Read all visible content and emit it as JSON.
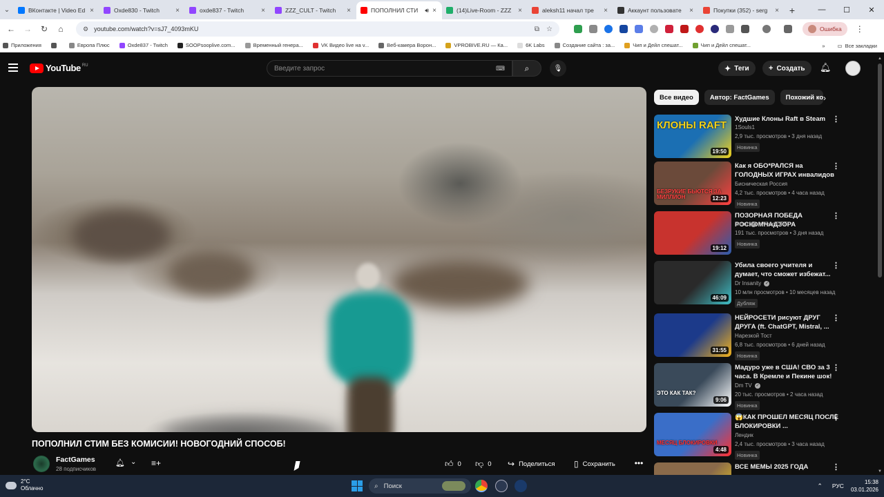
{
  "browser": {
    "tabs": [
      {
        "title": "ВКонтакте | Video Ed",
        "color": "#0077ff"
      },
      {
        "title": "Oxde830 - Twitch",
        "color": "#9146ff"
      },
      {
        "title": "oxde837 - Twitch",
        "color": "#9146ff"
      },
      {
        "title": "ZZZ_CULT - Twitch",
        "color": "#9146ff"
      },
      {
        "title": "ПОПОЛНИЛ СТИ",
        "color": "#ff0000",
        "active": true
      },
      {
        "title": "(14)Live-Room - ZZZ",
        "color": "#1fae6a"
      },
      {
        "title": "aleksh11 начал тре",
        "color": "#ea4335"
      },
      {
        "title": "Аккаунт пользовате",
        "color": "#333333"
      },
      {
        "title": "Покупки (352) - serg",
        "color": "#ea4335"
      }
    ],
    "url": "youtube.com/watch?v=sJ7_4093mKU",
    "error_label": "Ошибка",
    "bookmarks": [
      {
        "label": "Приложения",
        "color": "#555555"
      },
      {
        "label": "",
        "color": "#555555"
      },
      {
        "label": "Европа Плюс",
        "color": "#888888"
      },
      {
        "label": "Oxde837 - Twitch",
        "color": "#9146ff"
      },
      {
        "label": "SOOPsooplive.com...",
        "color": "#222222"
      },
      {
        "label": "Временный генера...",
        "color": "#999999"
      },
      {
        "label": "VK Видео live на v...",
        "color": "#e03030"
      },
      {
        "label": "Веб-камера Ворон...",
        "color": "#666666"
      },
      {
        "label": "VPROBIVE.RU — Ка...",
        "color": "#d4a21b"
      },
      {
        "label": "6K Labs",
        "color": "#dddddd"
      },
      {
        "label": "Создание сайта : за...",
        "color": "#888888"
      },
      {
        "label": "Чип и Дейл спешат...",
        "color": "#e0a020"
      },
      {
        "label": "Чип и Дейл спешат...",
        "color": "#70a030"
      }
    ],
    "all_bookmarks": "Все закладки"
  },
  "youtube": {
    "logo_text": "YouTube",
    "logo_country": "RU",
    "search_placeholder": "Введите запрос",
    "tags_label": "Теги",
    "create_label": "Создать",
    "video": {
      "title": "ПОПОЛНИЛ СТИМ БЕЗ КОМИСИИ! НОВОГОДНИЙ СПОСОБ!",
      "channel": "FactGames",
      "subscribers": "28 подписчиков",
      "likes": "0",
      "dislikes": "0",
      "share_label": "Поделиться",
      "save_label": "Сохранить"
    },
    "chips": [
      "Все видео",
      "Автор: FactGames",
      "Похожий ко"
    ],
    "recommendations": [
      {
        "title": "Худшие Клоны Raft в Steam",
        "channel": "1Souls1",
        "views": "2,9 тыс. просмотров • 3 дня назад",
        "badge": "Новинка",
        "duration": "19:50",
        "overlay": "КЛОНЫ RAFT",
        "bg": "#1b6fb3",
        "accent": "#f2d21b"
      },
      {
        "title": "Как я ОБО*РАЛСЯ на ГОЛОДНЫХ ИГРАХ инвалидов",
        "channel": "Бисническая Россия",
        "views": "4,2 тыс. просмотров • 4 часа назад",
        "badge": "Новинка",
        "duration": "12:23",
        "overlay": "БЕЗРУКИЕ БЬЮТСЯ ЗА МИЛЛИОН",
        "bg": "#6b4a3a",
        "accent": "#ff4040"
      },
      {
        "title": "ПОЗОРНАЯ ПОБЕДА РОСКОМНАДЗОРА",
        "channel": "слэш",
        "channel2": "и VeselOFF",
        "views": "191 тыс. просмотров • 3 дня назад",
        "badge": "Новинка",
        "duration": "19:12",
        "overlay": "",
        "bg": "#c8332e",
        "accent": "#2b5db0"
      },
      {
        "title": "Убила своего учителя и думает, что сможет избежат...",
        "channel": "Dr Insanity",
        "views": "10 млн просмотров • 10 месяцев назад",
        "badge": "Дубляж",
        "duration": "46:09",
        "overlay": "",
        "bg": "#2a2a2a",
        "accent": "#3fc0c8"
      },
      {
        "title": "НЕЙРОСЕТИ рисуют ДРУГ ДРУГА (ft. ChatGPT, Mistral, ...",
        "channel": "Нарезкой Тост",
        "views": "6,8 тыс. просмотров • 6 дней назад",
        "badge": "Новинка",
        "duration": "31:55",
        "overlay": "",
        "bg": "#1c3a8a",
        "accent": "#f2b21b"
      },
      {
        "title": "Мадуро уже в США! СВО за 3 часа. В Кремле и Пекине шок!",
        "channel": "Dm TV",
        "views": "20 тыс. просмотров • 2 часа назад",
        "badge": "Новинка",
        "duration": "9:06",
        "overlay": "ЭТО КАК ТАК?",
        "bg": "#3a4a5a",
        "accent": "#ffffff"
      },
      {
        "title": "😱КАК ПРОШЕЛ МЕСЯЦ ПОСЛЕ БЛОКИРОВКИ ...",
        "channel": "Лендик",
        "views": "2,4 тыс. просмотров • 3 часа назад",
        "badge": "Новинка",
        "duration": "4:48",
        "overlay": "МЕСЯЦ БЛОКИРОВКИ",
        "bg": "#3a6ec8",
        "accent": "#ff3030"
      },
      {
        "title": "ВСЕ МЕМЫ 2025 ГОДА",
        "channel": "",
        "views": "",
        "badge": "",
        "duration": "",
        "overlay": "",
        "bg": "#8a6a4a",
        "accent": "#f2d21b"
      }
    ]
  },
  "taskbar": {
    "temp": "2°C",
    "weather": "Облачно",
    "search_label": "Поиск",
    "lang": "РУС",
    "time": "15:38",
    "date": "03.01.2026"
  }
}
